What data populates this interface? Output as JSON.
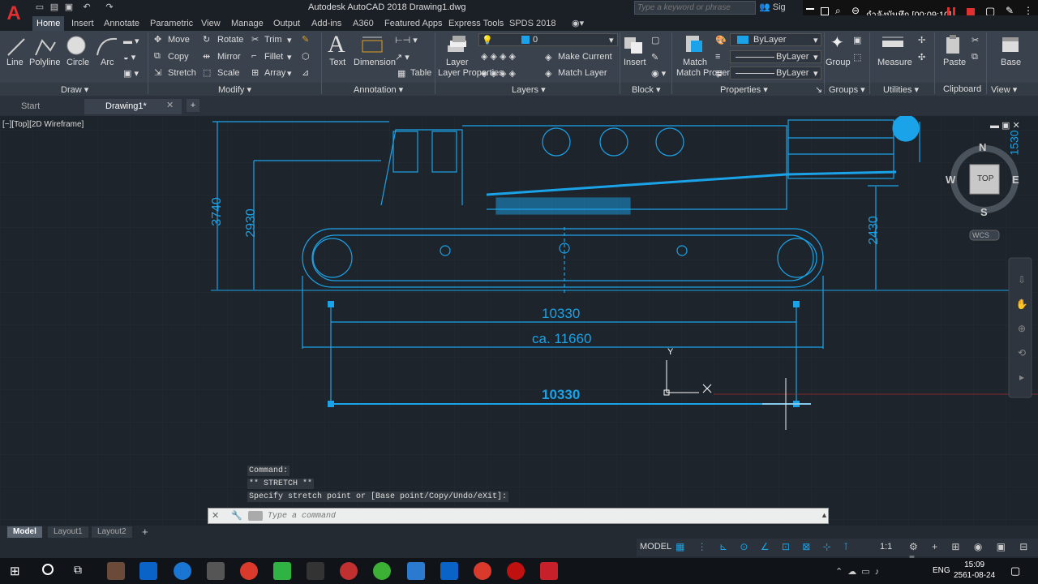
{
  "title": "Autodesk AutoCAD 2018    Drawing1.dwg",
  "search_placeholder": "Type a keyword or phrase",
  "recording": {
    "label": "กำลังบันทึก [00:09:10]"
  },
  "tabs": [
    "Home",
    "Insert",
    "Annotate",
    "Parametric",
    "View",
    "Manage",
    "Output",
    "Add-ins",
    "A360",
    "Featured Apps",
    "Express Tools",
    "SPDS 2018"
  ],
  "ribbon": {
    "draw": {
      "line": "Line",
      "polyline": "Polyline",
      "circle": "Circle",
      "arc": "Arc",
      "panel": "Draw ▾"
    },
    "modify": {
      "move": "Move",
      "rotate": "Rotate",
      "trim": "Trim",
      "copy": "Copy",
      "mirror": "Mirror",
      "fillet": "Fillet",
      "stretch": "Stretch",
      "scale": "Scale",
      "array": "Array",
      "panel": "Modify ▾"
    },
    "annotation": {
      "text": "Text",
      "dimension": "Dimension",
      "table": "Table",
      "panel": "Annotation ▾"
    },
    "layers": {
      "layer_properties": "Layer Properties",
      "layer_value": "0",
      "make_current": "Make Current",
      "match_layer": "Match Layer",
      "panel": "Layers ▾"
    },
    "block": {
      "insert": "Insert",
      "panel": "Block ▾"
    },
    "properties": {
      "match": "Match Properties",
      "color": "ByLayer",
      "linetype": "ByLayer",
      "lineweight": "ByLayer",
      "panel": "Properties ▾"
    },
    "groups": {
      "group": "Group",
      "panel": "Groups ▾"
    },
    "utilities": {
      "measure": "Measure",
      "panel": "Utilities ▾"
    },
    "clipboard": {
      "paste": "Paste",
      "panel": "Clipboard"
    },
    "view": {
      "base": "Base",
      "panel": "View ▾"
    }
  },
  "doc_tabs": {
    "start": "Start",
    "drawing": "Drawing1*"
  },
  "viewport_label": "[−][Top][2D Wireframe]",
  "drawing": {
    "dim_3740": "3740",
    "dim_2930": "2930",
    "dim_2430": "2430",
    "dim_1530": "1530",
    "dim_10330": "10330",
    "dim_11660": "ca. 11660",
    "dim_10330_b": "10330"
  },
  "viewcube": {
    "n": "N",
    "s": "S",
    "e": "E",
    "w": "W",
    "top": "TOP",
    "wcs": "WCS"
  },
  "ucs": {
    "x": "X",
    "y": "Y"
  },
  "command_history": [
    "Command:",
    "** STRETCH **",
    "Specify stretch point or [Base point/Copy/Undo/eXit]:"
  ],
  "command_placeholder": "Type a command",
  "layout_tabs": [
    "Model",
    "Layout1",
    "Layout2"
  ],
  "status": {
    "model": "MODEL",
    "scale": "1:1"
  },
  "tray": {
    "lang": "ENG",
    "time": "15:09",
    "date": "2561-08-24"
  },
  "colors": {
    "drawing": "#1aa3e8",
    "bg": "#1e242b",
    "ribbon": "#3a424d"
  }
}
